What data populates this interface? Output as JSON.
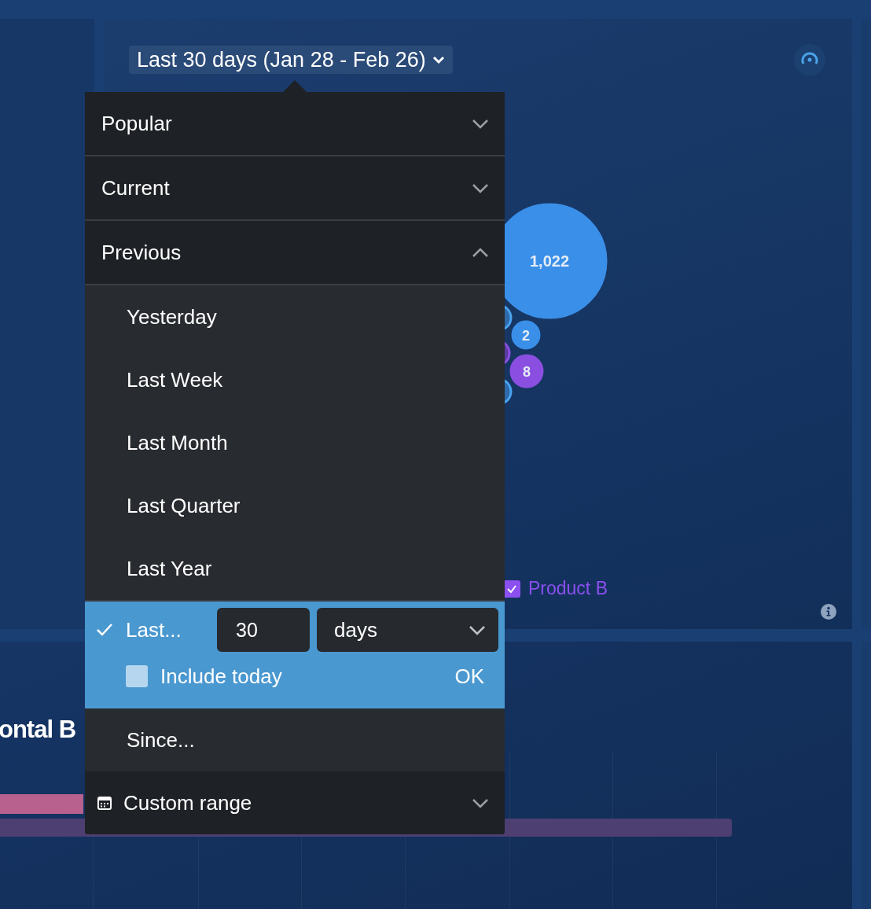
{
  "date_range_button": {
    "label": "Last 30 days (Jan 28 - Feb 26)"
  },
  "bubble_chart": {
    "bubbles": [
      {
        "label": "1,022",
        "color": "#3a8fe8"
      },
      {
        "label": "2",
        "color": "#3a8fe8"
      },
      {
        "label": "8",
        "color": "#8a4fe0"
      }
    ],
    "legend": [
      {
        "label": "Product B",
        "checked": true,
        "color": "#8c4ff0"
      }
    ]
  },
  "bar_panel": {
    "title": "ontal B"
  },
  "menu": {
    "groups": [
      {
        "label": "Popular",
        "expanded": false
      },
      {
        "label": "Current",
        "expanded": false
      },
      {
        "label": "Previous",
        "expanded": true,
        "options": [
          {
            "label": "Yesterday",
            "selected": false
          },
          {
            "label": "Last Week",
            "selected": false
          },
          {
            "label": "Last Month",
            "selected": false
          },
          {
            "label": "Last Quarter",
            "selected": false
          },
          {
            "label": "Last Year",
            "selected": false
          }
        ]
      }
    ],
    "last_option": {
      "label": "Last...",
      "selected": true,
      "count": "30",
      "unit": "days",
      "include_today": {
        "label": "Include today",
        "checked": false
      },
      "ok": "OK"
    },
    "since_option": {
      "label": "Since...",
      "selected": false
    },
    "custom_range": {
      "label": "Custom range",
      "expanded": false
    }
  }
}
